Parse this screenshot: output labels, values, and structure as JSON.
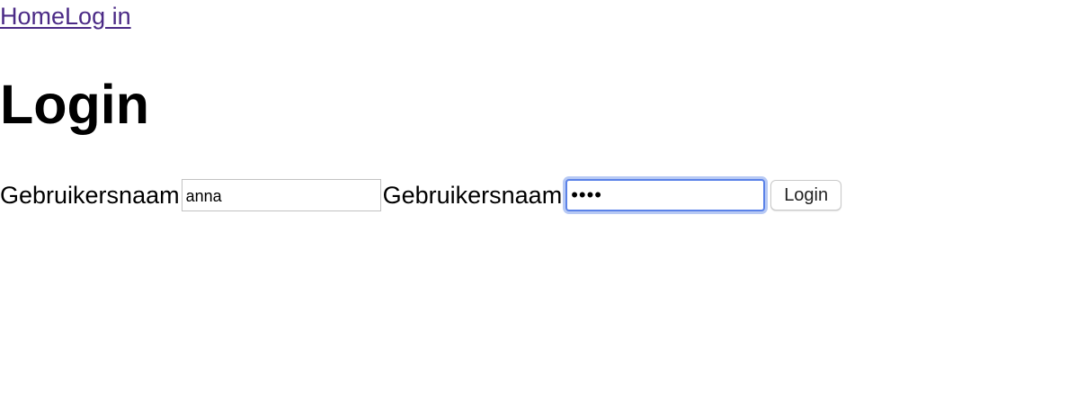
{
  "nav": {
    "home_label": "Home",
    "login_label": "Log in"
  },
  "page": {
    "title": "Login"
  },
  "form": {
    "username_label": "Gebruikersnaam",
    "username_value": "anna",
    "password_label": "Gebruikersnaam",
    "password_value": "anna",
    "submit_label": "Login"
  },
  "colors": {
    "link": "#4b2a86",
    "focus_ring": "#5b82e8"
  }
}
